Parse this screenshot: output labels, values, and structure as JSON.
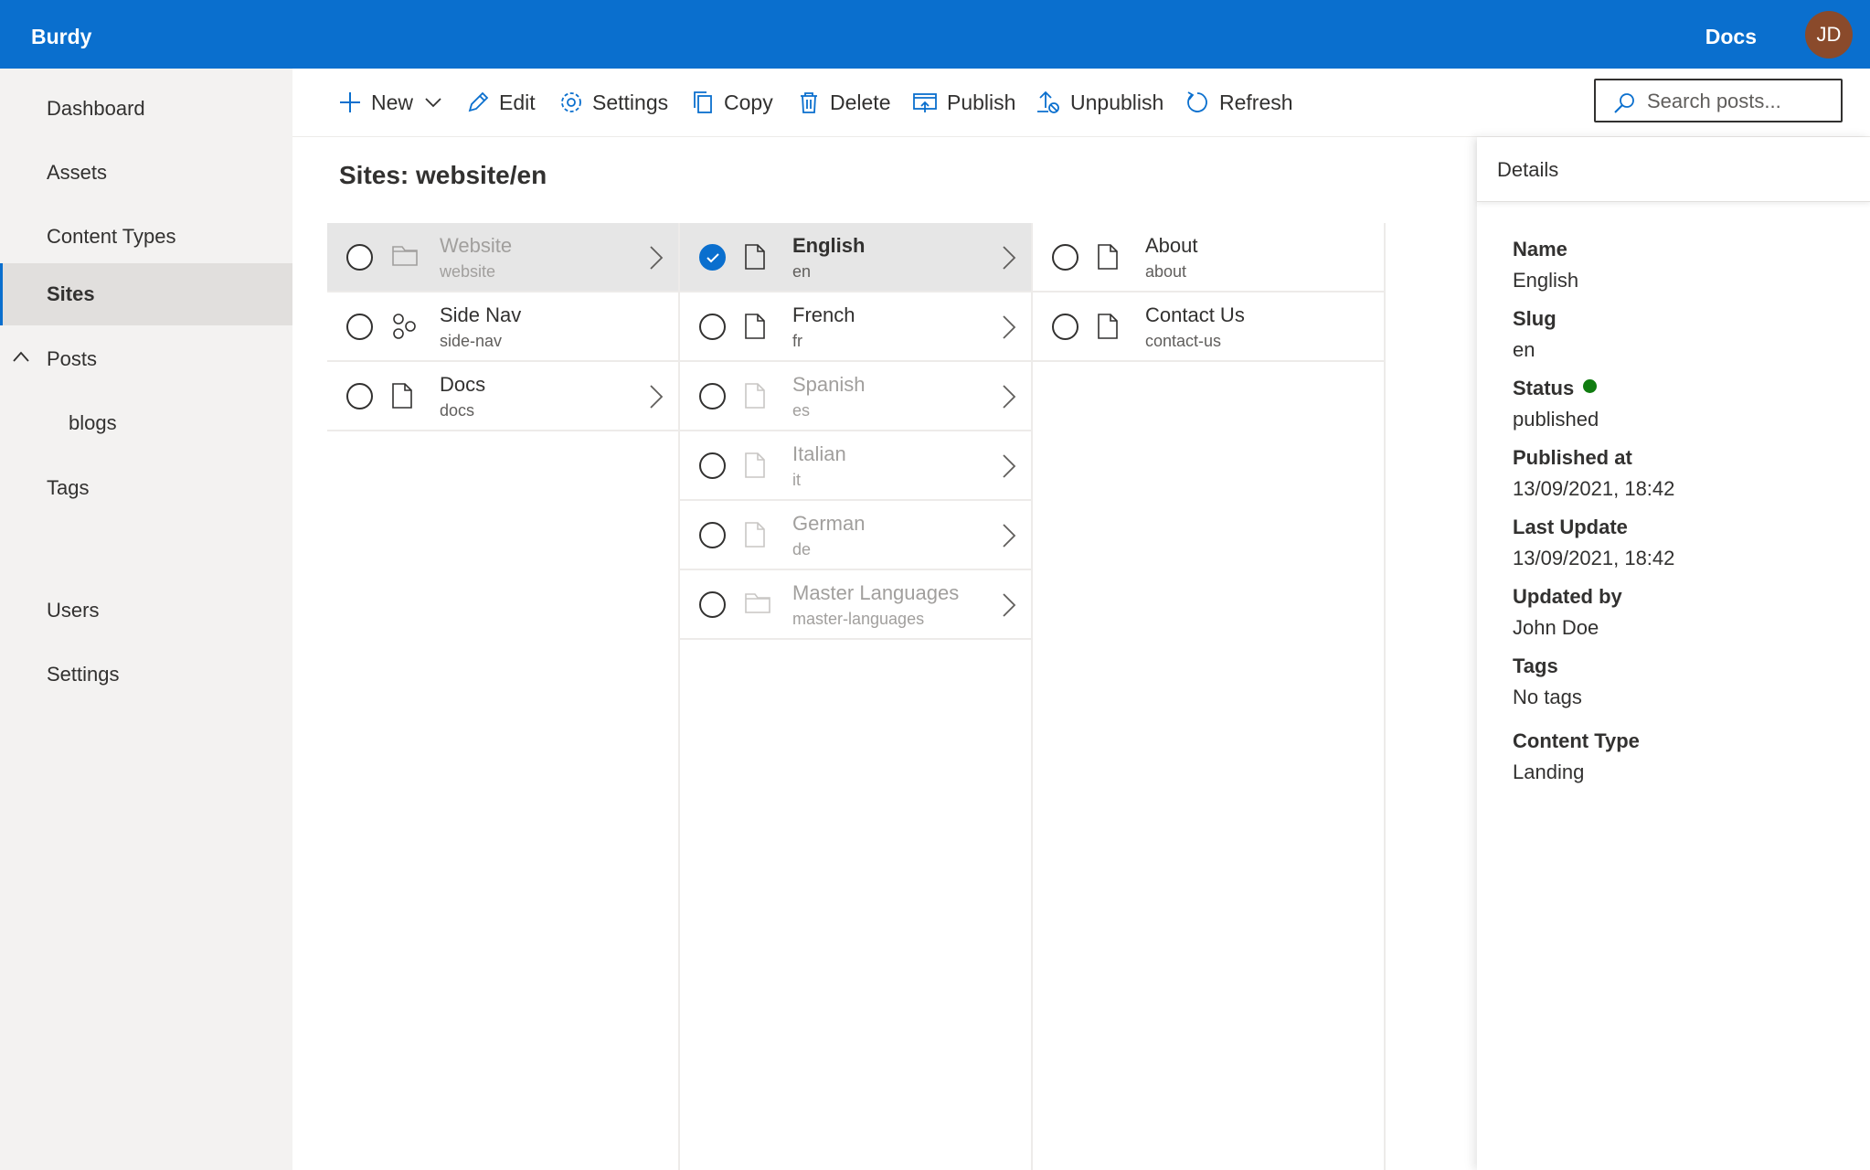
{
  "app": {
    "brand": "Burdy",
    "docs_link": "Docs",
    "user_initials": "JD"
  },
  "colors": {
    "accent": "#0a6fce",
    "status_published": "#107c10",
    "avatar_bg": "#8a4a2b"
  },
  "sidebar": {
    "items": [
      {
        "label": "Dashboard"
      },
      {
        "label": "Assets"
      },
      {
        "label": "Content Types"
      },
      {
        "label": "Sites",
        "active": true
      },
      {
        "label": "Posts",
        "expanded": true
      },
      {
        "label": "blogs"
      },
      {
        "label": "Tags"
      },
      {
        "label": "Users"
      },
      {
        "label": "Settings"
      }
    ]
  },
  "toolbar": {
    "new": "New",
    "edit": "Edit",
    "settings": "Settings",
    "copy": "Copy",
    "delete": "Delete",
    "publish": "Publish",
    "unpublish": "Unpublish",
    "refresh": "Refresh",
    "search_placeholder": "Search posts..."
  },
  "page": {
    "title": "Sites: website/en"
  },
  "columns": [
    {
      "rows": [
        {
          "title": "Website",
          "slug": "website",
          "icon": "folder-icon",
          "selected": true,
          "muted": true,
          "has_children": true
        },
        {
          "title": "Side Nav",
          "slug": "side-nav",
          "icon": "hierarchy-icon",
          "has_children": false
        },
        {
          "title": "Docs",
          "slug": "docs",
          "icon": "page-icon",
          "has_children": true
        }
      ]
    },
    {
      "rows": [
        {
          "title": "English",
          "slug": "en",
          "icon": "page-icon",
          "selected": true,
          "checked": true,
          "has_children": true
        },
        {
          "title": "French",
          "slug": "fr",
          "icon": "page-icon",
          "has_children": true
        },
        {
          "title": "Spanish",
          "slug": "es",
          "icon": "page-icon",
          "muted": true,
          "has_children": true
        },
        {
          "title": "Italian",
          "slug": "it",
          "icon": "page-icon",
          "muted": true,
          "has_children": true
        },
        {
          "title": "German",
          "slug": "de",
          "icon": "page-icon",
          "muted": true,
          "has_children": true
        },
        {
          "title": "Master Languages",
          "slug": "master-languages",
          "icon": "folder-icon",
          "muted": true,
          "has_children": true
        }
      ]
    },
    {
      "rows": [
        {
          "title": "About",
          "slug": "about",
          "icon": "page-icon"
        },
        {
          "title": "Contact Us",
          "slug": "contact-us",
          "icon": "page-icon"
        }
      ]
    }
  ],
  "details": {
    "header": "Details",
    "fields": [
      {
        "label": "Name",
        "value": "English"
      },
      {
        "label": "Slug",
        "value": "en"
      },
      {
        "label": "Status",
        "value": "published"
      },
      {
        "label": "Published at",
        "value": "13/09/2021, 18:42"
      },
      {
        "label": "Last Update",
        "value": "13/09/2021, 18:42"
      },
      {
        "label": "Updated by",
        "value": "John Doe"
      },
      {
        "label": "Tags",
        "value": "No tags"
      },
      {
        "label": "Content Type",
        "value": "Landing"
      }
    ]
  }
}
